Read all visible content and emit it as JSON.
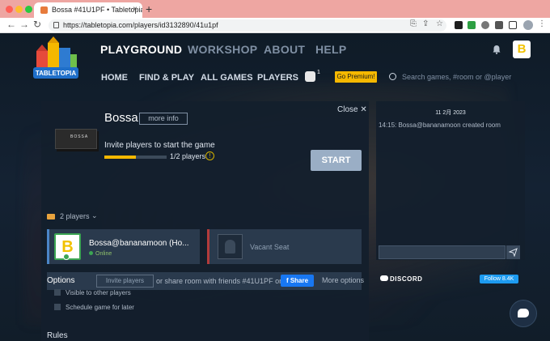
{
  "browser": {
    "tab_title": "Bossa #41U1PF • Tabletopia",
    "tab_close": "×",
    "new_tab": "+",
    "url": "https://tabletopia.com/players/id3132890/41u1pf",
    "back": "←",
    "forward": "→",
    "reload": "↻"
  },
  "site": {
    "logo_text": "TABLETOPIA",
    "top_nav": [
      "PLAYGROUND",
      "WORKSHOP",
      "ABOUT",
      "HELP"
    ],
    "sub_nav": [
      "HOME",
      "FIND & PLAY",
      "ALL GAMES",
      "PLAYERS"
    ],
    "dice_count": "1",
    "premium_label": "Go Premium!",
    "search_placeholder": "Search games, #room or @player",
    "avatar_letter": "B"
  },
  "room": {
    "close_label": "Close ✕",
    "game_title": "Bossa",
    "box_label": "BOSSA",
    "more_info": "more info",
    "invite_text": "Invite players to start the game",
    "players_progress": 0.5,
    "player_count_text": "1/2 players",
    "warning": "!",
    "start_label": "START",
    "players_toggle": "2 players",
    "players": [
      {
        "name": "Bossa@bananamoon (Ho...",
        "status": "Online",
        "avatar_letter": "B"
      }
    ],
    "vacant_label": "Vacant Seat",
    "invite_button": "Invite players",
    "share_text": "or share room with friends #41U1PF or",
    "fb_share": "Share",
    "options_title": "Options",
    "more_options": "More options",
    "options": [
      "Visible to other players",
      "Schedule game for later"
    ],
    "rules_title": "Rules"
  },
  "chat": {
    "date": "11 2月 2023",
    "messages": [
      "14:15: Bossa@bananamoon created room"
    ],
    "discord_label": "DISCORD",
    "follow_label": "Follow 8.4K"
  },
  "colors": {
    "accent": "#f5b800",
    "start_button": "#9aaec5",
    "facebook": "#1877f2",
    "twitter": "#1d9bf0",
    "online": "#3ca653"
  }
}
